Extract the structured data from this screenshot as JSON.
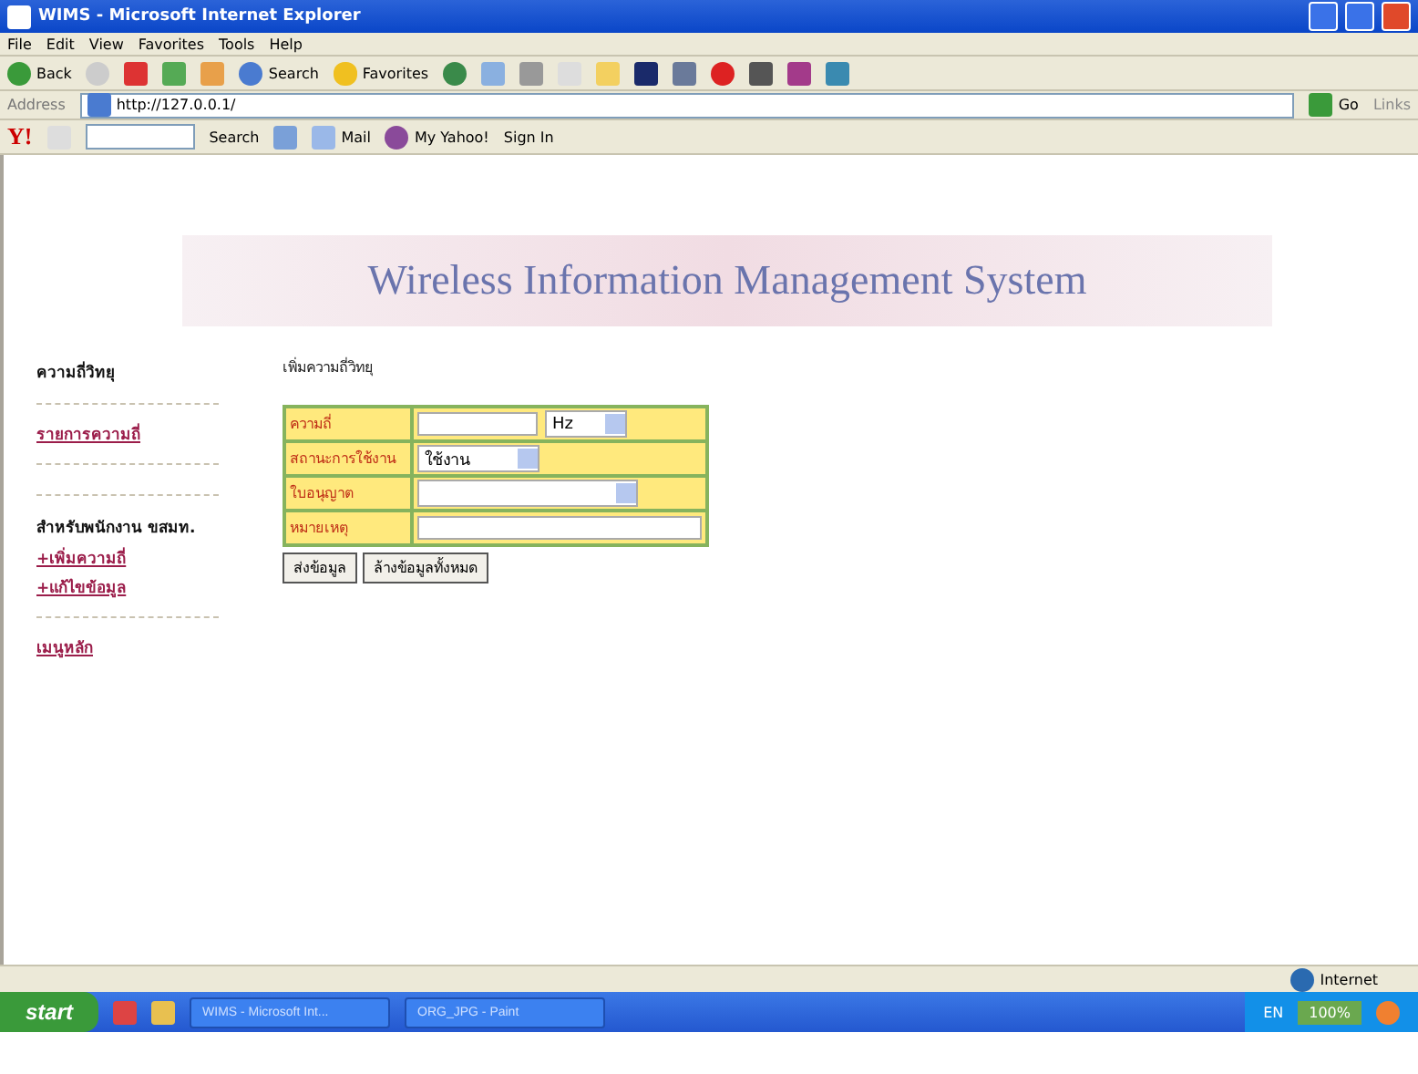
{
  "window": {
    "title": "WIMS - Microsoft Internet Explorer"
  },
  "menu": [
    "File",
    "Edit",
    "View",
    "Favorites",
    "Tools",
    "Help"
  ],
  "toolbar": {
    "back": "Back",
    "search": "Search",
    "favorites": "Favorites"
  },
  "address": {
    "label": "Address",
    "value": "http://127.0.0.1/",
    "go": "Go",
    "links": "Links"
  },
  "yahoo_bar": {
    "logo": "Y!",
    "search": "Search",
    "mail": "Mail",
    "my_yahoo": "My Yahoo!",
    "sign_in": "Sign In"
  },
  "banner": "Wireless Information Management System",
  "sidebar": [
    {
      "kind": "heading",
      "text": "ความถี่วิทยุ"
    },
    {
      "kind": "rule"
    },
    {
      "kind": "link",
      "text": "รายการความถี่"
    },
    {
      "kind": "rule"
    },
    {
      "kind": "rule"
    },
    {
      "kind": "heading",
      "text": "สำหรับพนักงาน ขสมท."
    },
    {
      "kind": "link",
      "text": "+เพิ่มความถี่"
    },
    {
      "kind": "link",
      "text": "+แก้ไขข้อมูล"
    },
    {
      "kind": "rule"
    },
    {
      "kind": "link",
      "text": "เมนูหลัก"
    }
  ],
  "form": {
    "title": "เพิ่มความถี่วิทยุ",
    "rows": [
      {
        "label": "ความถี่",
        "kind": "number_unit",
        "unit": "Hz"
      },
      {
        "label": "สถานะการใช้งาน",
        "kind": "select",
        "value": "ใช้งาน"
      },
      {
        "label": "ใบอนุญาต",
        "kind": "wide_select"
      },
      {
        "label": "หมายเหตุ",
        "kind": "text"
      }
    ],
    "buttons": [
      "ส่งข้อมูล",
      "ล้างข้อมูลทั้งหมด"
    ]
  },
  "status_bar": {
    "zone": "Internet"
  },
  "taskbar": {
    "start": "start",
    "tasks": [
      "WIMS - Microsoft Int...",
      "ORG_JPG - Paint"
    ],
    "tray": [
      "EN",
      "100%"
    ]
  }
}
